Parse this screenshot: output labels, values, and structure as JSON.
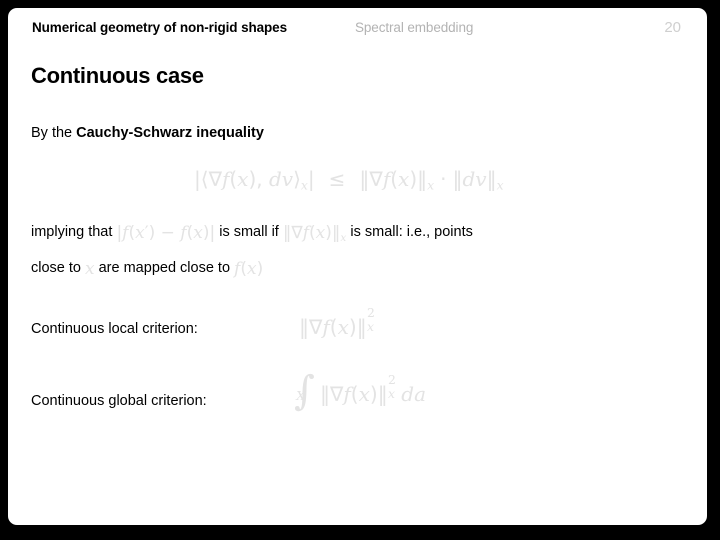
{
  "slide": {
    "header": {
      "course_title": "Numerical geometry of non-rigid shapes",
      "topic": "Spectral embedding",
      "page_number": "20"
    },
    "title": "Continuous case",
    "body": {
      "cauchy_prefix": "By the ",
      "cauchy_bold": "Cauchy-Schwarz inequality",
      "implying_prefix": "implying that ",
      "implying_mid": " is small if ",
      "implying_suffix": " is small: i.e., points",
      "closeto_prefix": "close to ",
      "closeto_mid": " are mapped close to ",
      "local_criterion_label": "Continuous local criterion:",
      "global_criterion_label": "Continuous global criterion:"
    },
    "math": {
      "cauchy_schwarz": "|<∇f(x), dv>_x| ≤ ||∇f(x)||_x · ||dv||_x",
      "difference": "|f(x') − f(x)|",
      "gradient_norm": "||∇f(x)||_x",
      "point_x": "x",
      "map_fx": "f(x)",
      "local_criterion": "||∇f(x)||_x^2",
      "global_criterion": "∫_X ||∇f(x)||_x^2 da",
      "symbols": {
        "abs": "|",
        "dbl_bar": "||",
        "angle_open": "⟨",
        "angle_close": "⟩",
        "nabla": "∇",
        "leq": "≤",
        "cdot": "·",
        "minus": "−",
        "integral": "∫",
        "sup_two": "2",
        "sub_x": "x",
        "sub_X": "X",
        "f": "f",
        "x": "x",
        "x_prime": "x′",
        "dv": "dv",
        "da": "da",
        "paren_open": "(",
        "paren_close": ")",
        "comma": ","
      }
    },
    "colors": {
      "frame": "#000000",
      "surface": "#ffffff",
      "text": "#000000",
      "muted": "#b3b3b3",
      "page_number": "#cfcfcf",
      "math_faded": "#e3e3e3"
    }
  }
}
